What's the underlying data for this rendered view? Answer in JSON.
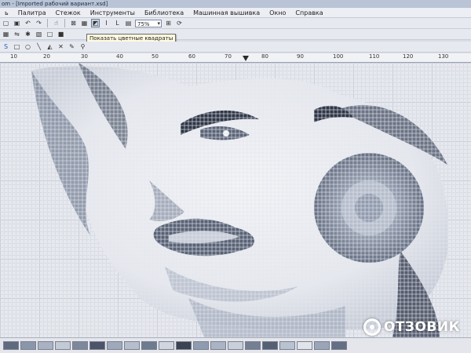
{
  "window": {
    "title": "om - [Imported рабочий вариант.xsd]"
  },
  "menu": {
    "items": [
      "ь",
      "Палитра",
      "Стежок",
      "Инструменты",
      "Библиотека",
      "Машинная вышивка",
      "Окно",
      "Справка"
    ]
  },
  "toolbar": {
    "zoom_value": "75%",
    "tooltip": "Показать цветные квадраты"
  },
  "ruler": {
    "labels": [
      "10",
      "20",
      "30",
      "40",
      "50",
      "60",
      "70",
      "80",
      "90",
      "100",
      "110",
      "120",
      "130"
    ]
  },
  "palette": {
    "colors": [
      "#5f6a7e",
      "#8a96aa",
      "#a8b2c2",
      "#c2cad6",
      "#7d889c",
      "#4b5468",
      "#9ea9bb",
      "#b5bfcc",
      "#6e7a8f",
      "#d0d6df",
      "#3b4254",
      "#8f9bb0",
      "#aab4c4",
      "#c9d0da",
      "#747f93",
      "#566074",
      "#b9c2cf",
      "#e0e4ea",
      "#9aa5b7",
      "#646f83",
      "#cfd5de",
      "#8894a8",
      "#adb7c6",
      "#50596c"
    ]
  },
  "watermark": {
    "text": "ОТЗОВИК"
  },
  "icons": {
    "stitch": "cross-stitch-icon",
    "colored-squares": "colored-squares-icon"
  }
}
